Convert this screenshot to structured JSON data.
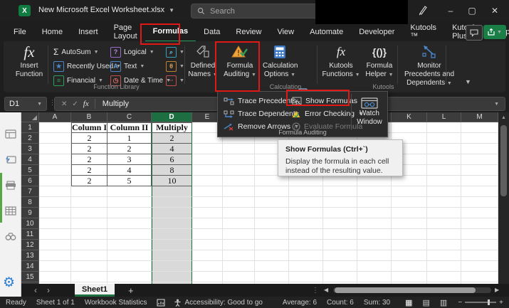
{
  "window": {
    "title": "New Microsoft Excel Worksheet.xlsx",
    "search_placeholder": "Search",
    "minimize": "–",
    "maximize": "▢",
    "close": "✕"
  },
  "tabs": {
    "items": [
      "File",
      "Home",
      "Insert",
      "Page Layout",
      "Formulas",
      "Data",
      "Review",
      "View",
      "Automate",
      "Developer",
      "Kutools ™",
      "Kutools Plus",
      "Help"
    ],
    "active": "Formulas"
  },
  "ribbon": {
    "insert_function_label": "Insert Function",
    "function_library": {
      "autosum": "AutoSum",
      "recently_used": "Recently Used",
      "financial": "Financial",
      "logical": "Logical",
      "text": "Text",
      "date_time": "Date & Time",
      "group_label": "Function Library"
    },
    "defined_names_label": "Defined Names",
    "formula_auditing_label": "Formula Auditing",
    "calculation_options_label": "Calculation Options",
    "calculation_group_label": "Calculation",
    "kutools_functions_label": "Kutools Functions",
    "formula_helper_label": "Formula Helper",
    "monitor_label": "Monitor Precedents and Dependents",
    "kutools_group_label": "Kutools"
  },
  "auditing_menu": {
    "trace_precedents": "Trace Precedents",
    "trace_dependents": "Trace Dependents",
    "remove_arrows": "Remove Arrows",
    "show_formulas": "Show Formulas",
    "error_checking": "Error Checking",
    "evaluate_formula": "Evaluate Formula",
    "watch_window": "Watch Window",
    "group_label": "Formula Auditing"
  },
  "tooltip": {
    "title": "Show Formulas (Ctrl+`)",
    "line1": "Display the formula in each cell",
    "line2": "instead of the resulting value."
  },
  "formula_bar": {
    "name_box": "D1",
    "value": "Multiply"
  },
  "grid": {
    "columns": [
      "A",
      "B",
      "C",
      "D",
      "E",
      "F",
      "G",
      "H",
      "I",
      "J",
      "K",
      "L",
      "M"
    ],
    "selected_column": "D",
    "row_count": 16,
    "cells": {
      "B1": "Column I",
      "C1": "Column II",
      "D1": "Multiply",
      "B2": "2",
      "C2": "1",
      "D2": "2",
      "B3": "2",
      "C3": "2",
      "D3": "4",
      "B4": "2",
      "C4": "3",
      "D4": "6",
      "B5": "2",
      "C5": "4",
      "D5": "8",
      "B6": "2",
      "C6": "5",
      "D6": "10"
    }
  },
  "sheet_bar": {
    "active_sheet": "Sheet1",
    "add_label": "+",
    "prev": "‹",
    "next": "›"
  },
  "status_bar": {
    "ready": "Ready",
    "sheet_count": "Sheet 1 of 1",
    "workbook_stats": "Workbook Statistics",
    "accessibility": "Accessibility: Good to go",
    "average": "Average: 6",
    "count": "Count: 6",
    "sum": "Sum: 30"
  },
  "colors": {
    "accent_green": "#1d6f42",
    "annotation_red": "#e11916",
    "selection_fill": "#d9d9d9",
    "share_green": "#1a7f47"
  }
}
